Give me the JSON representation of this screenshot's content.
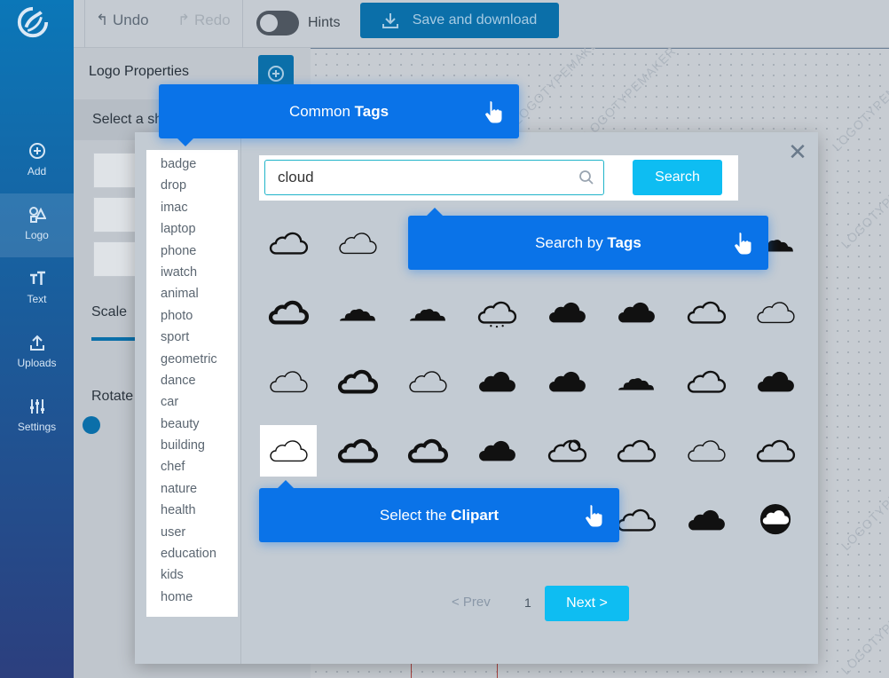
{
  "sidebar": {
    "items": [
      {
        "label": "Add",
        "icon": "plus-circle-icon"
      },
      {
        "label": "Logo",
        "icon": "shapes-icon"
      },
      {
        "label": "Text",
        "icon": "text-icon"
      },
      {
        "label": "Uploads",
        "icon": "upload-icon"
      },
      {
        "label": "Settings",
        "icon": "sliders-icon"
      }
    ]
  },
  "toolbar": {
    "undo_label": "Undo",
    "redo_label": "Redo",
    "hints_label": "Hints",
    "save_label": "Save and download"
  },
  "panel": {
    "title": "Logo Properties",
    "select_shape": "Select a sh",
    "scale_label": "Scale",
    "rotate_label": "Rotate"
  },
  "watermark": "LOGOTYPEMAKER",
  "modal": {
    "tags": [
      "badge",
      "drop",
      "imac",
      "laptop",
      "phone",
      "iwatch",
      "animal",
      "photo",
      "sport",
      "geometric",
      "dance",
      "car",
      "beauty",
      "building",
      "chef",
      "nature",
      "health",
      "user",
      "education",
      "kids",
      "home"
    ],
    "search": {
      "value": "cloud",
      "button": "Search"
    },
    "pagination": {
      "prev": "< Prev",
      "current": "1",
      "next": "Next >"
    }
  },
  "callouts": {
    "common_tags": {
      "prefix": "Common ",
      "bold": "Tags"
    },
    "search_tags": {
      "prefix": "Search by ",
      "bold": "Tags"
    },
    "select_clipart": {
      "prefix": "Select the ",
      "bold": "Clipart"
    }
  },
  "colors": {
    "accent": "#0a73e8",
    "button": "#0ebdf2",
    "sidebar_top": "#0b77b8"
  }
}
